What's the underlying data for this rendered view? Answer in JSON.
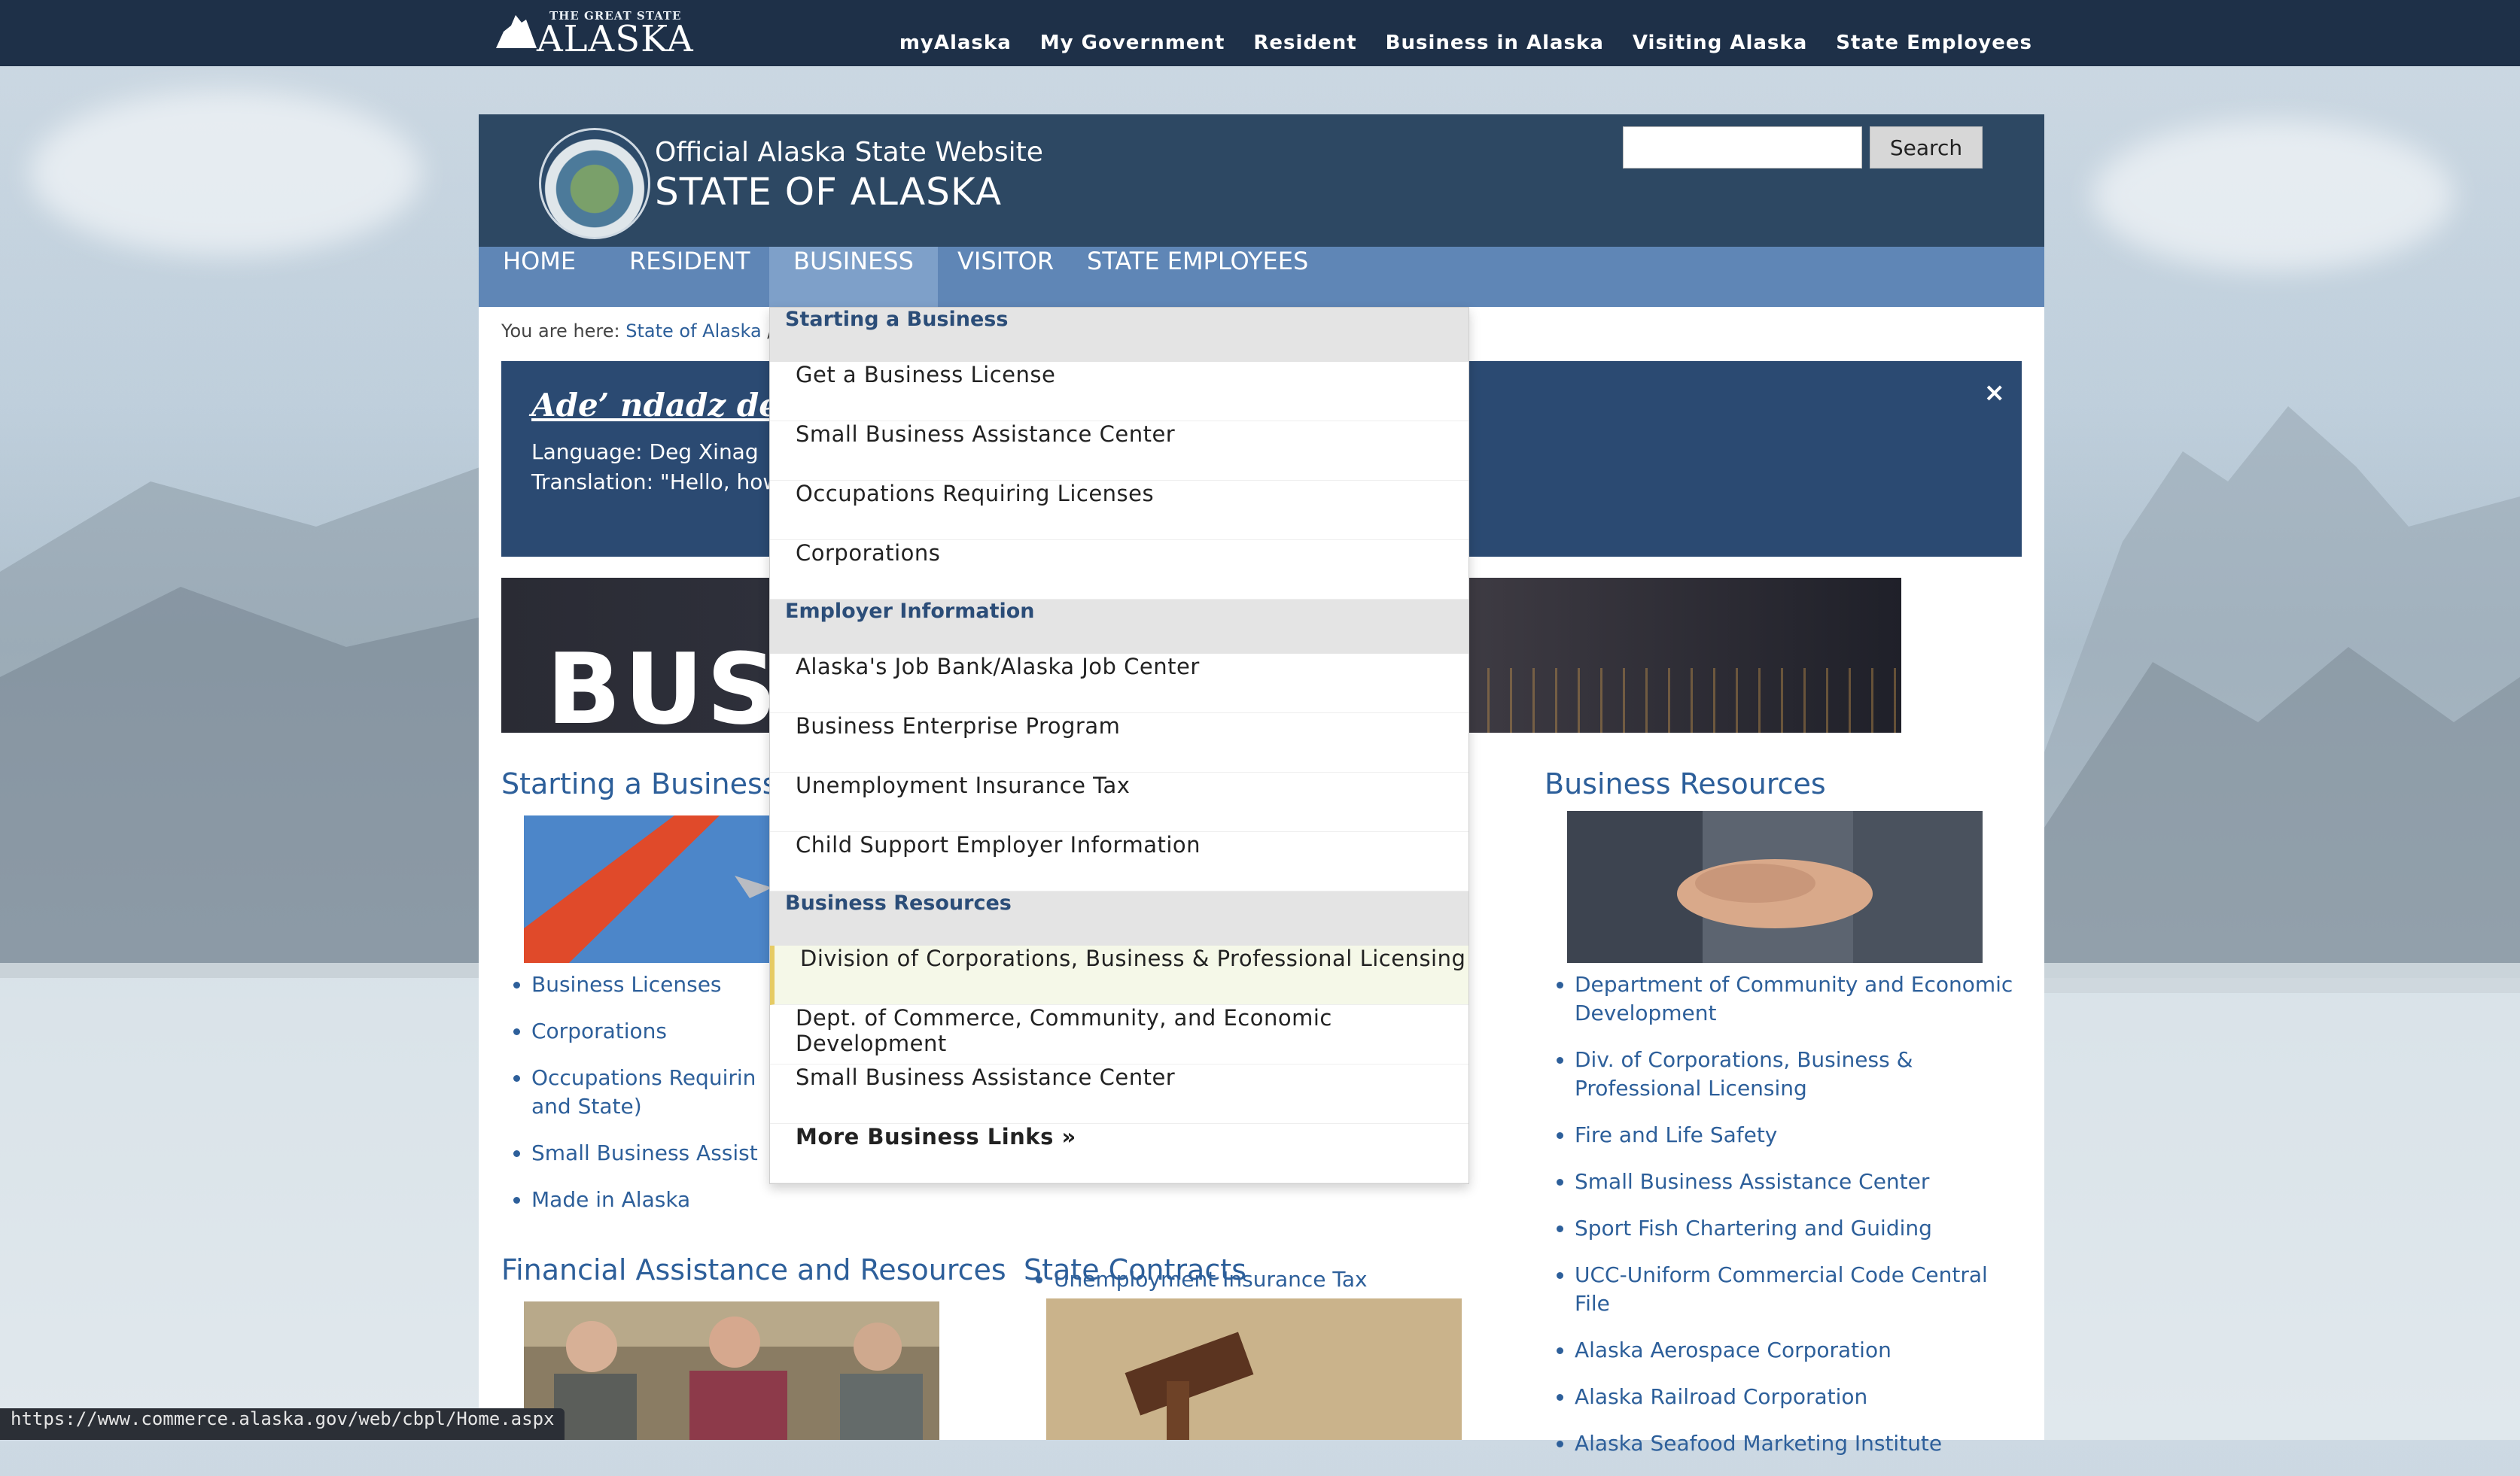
{
  "topbar": {
    "logo_small": "THE GREAT STATE",
    "logo_big": "ALASKA",
    "nav": [
      "myAlaska",
      "My Government",
      "Resident",
      "Business in Alaska",
      "Visiting Alaska",
      "State Employees"
    ]
  },
  "header": {
    "official": "Official Alaska State Website",
    "state": "STATE OF ALASKA",
    "search_value": "",
    "search_button": "Search"
  },
  "mainnav": [
    "HOME",
    "RESIDENT",
    "BUSINESS",
    "VISITOR",
    "STATE EMPLOYEES"
  ],
  "breadcrumb": {
    "prefix": "You are here:",
    "link": "State of Alaska",
    "sep": "/ B"
  },
  "alert": {
    "title": "Ade’ ndadz den",
    "language": "Language: Deg Xinag",
    "translation": "Translation: \"Hello, how",
    "close": "×"
  },
  "banner": {
    "text": "BUSI"
  },
  "sections": {
    "starting": {
      "title": "Starting a Business",
      "links": [
        "Business Licenses",
        "Corporations",
        "Occupations Requirin",
        "and State)",
        "Small Business Assist",
        "Made in Alaska"
      ]
    },
    "middle_links": [
      "Unemployment Insurance Tax"
    ],
    "resources": {
      "title": "Business Resources",
      "links": [
        "Department of Community and Economic Development",
        "Div. of Corporations, Business & Professional Licensing",
        "Fire and Life Safety",
        "Small Business Assistance Center",
        "Sport Fish Chartering and Guiding",
        "UCC-Uniform Commercial Code Central File",
        "Alaska Aerospace Corporation",
        "Alaska Railroad Corporation",
        "Alaska Seafood Marketing Institute"
      ]
    },
    "financial": {
      "title": "Financial Assistance and Resources"
    },
    "contracts": {
      "title": "State Contracts"
    }
  },
  "dropdown": {
    "groups": [
      {
        "heading": "Starting a Business",
        "items": [
          "Get a Business License",
          "Small Business Assistance Center",
          "Occupations Requiring Licenses",
          "Corporations"
        ]
      },
      {
        "heading": "Employer Information",
        "items": [
          "Alaska's Job Bank/Alaska Job Center",
          "Business Enterprise Program",
          "Unemployment Insurance Tax",
          "Child Support Employer Information"
        ]
      },
      {
        "heading": "Business Resources",
        "items": [
          "Division of Corporations, Business & Professional Licensing",
          "Dept. of Commerce, Community, and Economic Development",
          "Small Business Assistance Center",
          "More Business Links »"
        ]
      }
    ]
  },
  "status_url": "https://www.commerce.alaska.gov/web/cbpl/Home.aspx",
  "colors": {
    "topbar": "#1e3048",
    "header": "#2d4863",
    "nav": "#5f86b6",
    "link": "#2d5f9a",
    "alert": "#2b4a72"
  }
}
